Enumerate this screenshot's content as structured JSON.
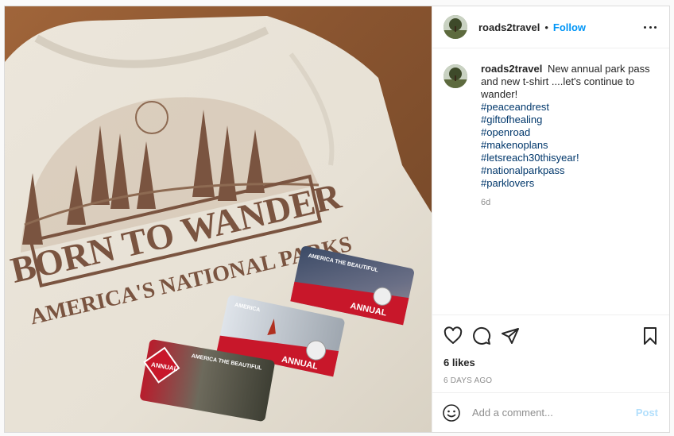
{
  "post": {
    "photo": {
      "shirt_headline": "BORN TO WANDER",
      "shirt_subline": "AMERICA'S NATIONAL PARKS",
      "cards": [
        {
          "top_text": "AMERICA THE BEAUTIFUL",
          "badge": "ANNUAL"
        },
        {
          "top_text": "AMERICA",
          "badge": "ANNUAL"
        },
        {
          "top_text": "AMERICA THE BEAUTIFUL",
          "badge": "ANNUAL"
        }
      ]
    },
    "header": {
      "username": "roads2travel",
      "separator": "•",
      "follow_label": "Follow"
    },
    "caption": {
      "username": "roads2travel",
      "text": "New annual park pass and new t-shirt ....let's continue to wander!",
      "hashtags": [
        "#peaceandrest",
        "#giftofhealing",
        "#openroad",
        "#makenoplans",
        "#letsreach30thisyear!",
        "#nationalparkpass",
        "#parklovers"
      ],
      "time": "6d"
    },
    "actions": {
      "icons": [
        "heart-icon",
        "comment-icon",
        "share-icon",
        "bookmark-icon"
      ],
      "likes": "6 likes",
      "time_ago": "6 DAYS AGO"
    },
    "comment_box": {
      "placeholder": "Add a comment...",
      "post_label": "Post"
    },
    "colors": {
      "link": "#0095f6",
      "hashtag": "#00376b",
      "post_disabled": "#b2dffc",
      "muted": "#8e8e8e"
    }
  }
}
